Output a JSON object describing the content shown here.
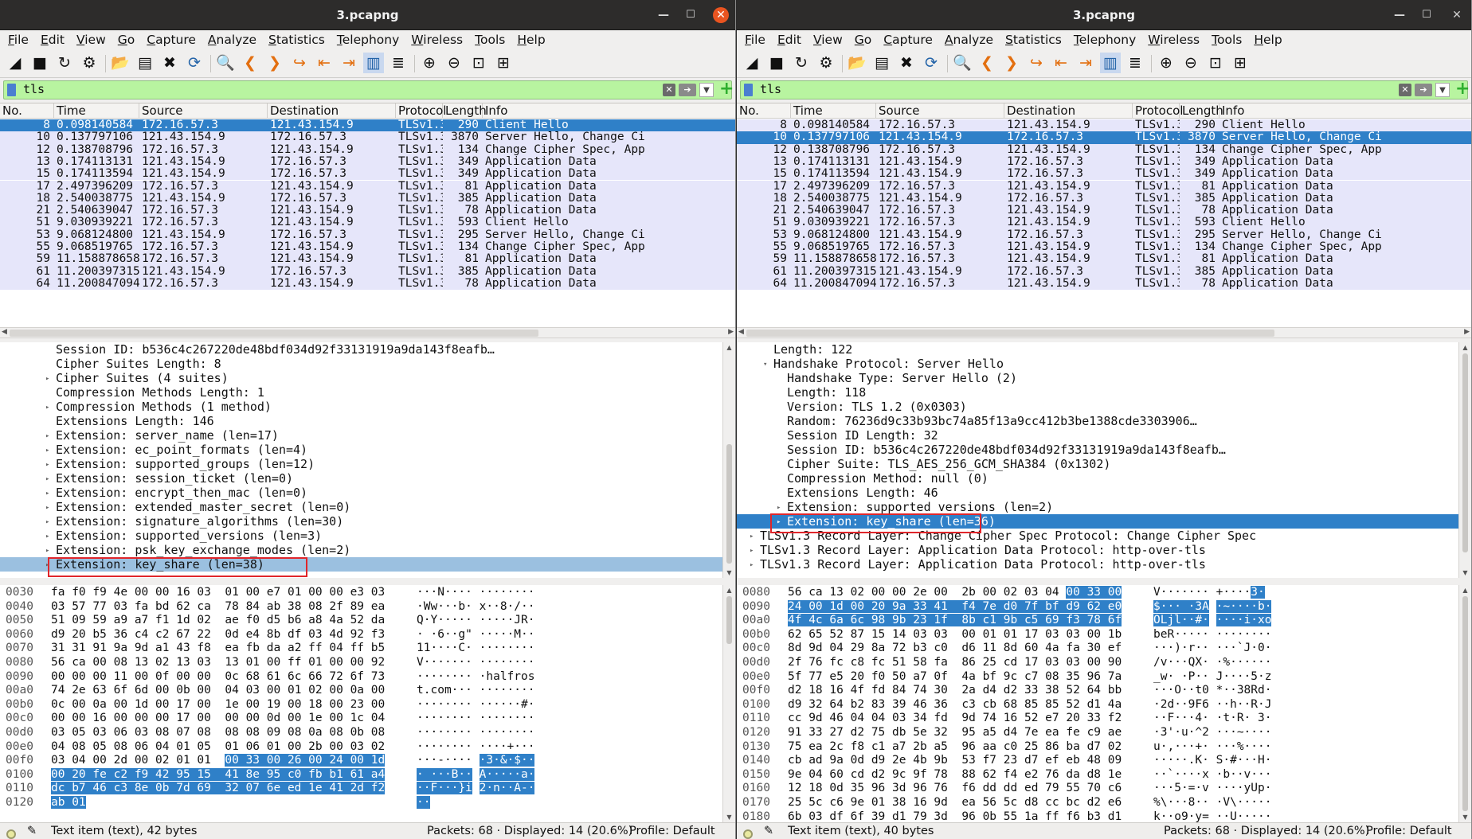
{
  "windows": [
    {
      "id": "L",
      "title": "3.pcapng",
      "menu": [
        "File",
        "Edit",
        "View",
        "Go",
        "Capture",
        "Analyze",
        "Statistics",
        "Telephony",
        "Wireless",
        "Tools",
        "Help"
      ],
      "filter": "tls",
      "columns": [
        "No.",
        "Time",
        "Source",
        "Destination",
        "Protocol",
        "Length",
        "Info"
      ],
      "selected_row": 0,
      "packets": [
        [
          "8",
          "0.098140584",
          "172.16.57.3",
          "121.43.154.9",
          "TLSv1.3",
          "290",
          "Client Hello"
        ],
        [
          "10",
          "0.137797106",
          "121.43.154.9",
          "172.16.57.3",
          "TLSv1.3",
          "3870",
          "Server Hello, Change Ci"
        ],
        [
          "12",
          "0.138708796",
          "172.16.57.3",
          "121.43.154.9",
          "TLSv1.3",
          "134",
          "Change Cipher Spec, App"
        ],
        [
          "13",
          "0.174113131",
          "121.43.154.9",
          "172.16.57.3",
          "TLSv1.3",
          "349",
          "Application Data"
        ],
        [
          "15",
          "0.174113594",
          "121.43.154.9",
          "172.16.57.3",
          "TLSv1.3",
          "349",
          "Application Data"
        ],
        [
          "17",
          "2.497396209",
          "172.16.57.3",
          "121.43.154.9",
          "TLSv1.3",
          "81",
          "Application Data"
        ],
        [
          "18",
          "2.540038775",
          "121.43.154.9",
          "172.16.57.3",
          "TLSv1.3",
          "385",
          "Application Data"
        ],
        [
          "21",
          "2.540639047",
          "172.16.57.3",
          "121.43.154.9",
          "TLSv1.3",
          "78",
          "Application Data"
        ],
        [
          "51",
          "9.030939221",
          "172.16.57.3",
          "121.43.154.9",
          "TLSv1.3",
          "593",
          "Client Hello"
        ],
        [
          "53",
          "9.068124800",
          "121.43.154.9",
          "172.16.57.3",
          "TLSv1.3",
          "295",
          "Server Hello, Change Ci"
        ],
        [
          "55",
          "9.068519765",
          "172.16.57.3",
          "121.43.154.9",
          "TLSv1.3",
          "134",
          "Change Cipher Spec, App"
        ],
        [
          "59",
          "11.158878658",
          "172.16.57.3",
          "121.43.154.9",
          "TLSv1.3",
          "81",
          "Application Data"
        ],
        [
          "61",
          "11.200397315",
          "121.43.154.9",
          "172.16.57.3",
          "TLSv1.3",
          "385",
          "Application Data"
        ],
        [
          "64",
          "11.200847094",
          "172.16.57.3",
          "121.43.154.9",
          "TLSv1.3",
          "78",
          "Application Data"
        ]
      ],
      "details": [
        {
          "indent": 0,
          "exp": "",
          "text": "Session ID: b536c4c267220de48bdf034d92f33131919a9da143f8eafb…"
        },
        {
          "indent": 0,
          "exp": "",
          "text": "Cipher Suites Length: 8"
        },
        {
          "indent": 0,
          "exp": "▸",
          "text": "Cipher Suites (4 suites)"
        },
        {
          "indent": 0,
          "exp": "",
          "text": "Compression Methods Length: 1"
        },
        {
          "indent": 0,
          "exp": "▸",
          "text": "Compression Methods (1 method)"
        },
        {
          "indent": 0,
          "exp": "",
          "text": "Extensions Length: 146"
        },
        {
          "indent": 0,
          "exp": "▸",
          "text": "Extension: server_name (len=17)"
        },
        {
          "indent": 0,
          "exp": "▸",
          "text": "Extension: ec_point_formats (len=4)"
        },
        {
          "indent": 0,
          "exp": "▸",
          "text": "Extension: supported_groups (len=12)"
        },
        {
          "indent": 0,
          "exp": "▸",
          "text": "Extension: session_ticket (len=0)"
        },
        {
          "indent": 0,
          "exp": "▸",
          "text": "Extension: encrypt_then_mac (len=0)"
        },
        {
          "indent": 0,
          "exp": "▸",
          "text": "Extension: extended_master_secret (len=0)"
        },
        {
          "indent": 0,
          "exp": "▸",
          "text": "Extension: signature_algorithms (len=30)"
        },
        {
          "indent": 0,
          "exp": "▸",
          "text": "Extension: supported_versions (len=3)"
        },
        {
          "indent": 0,
          "exp": "▸",
          "text": "Extension: psk_key_exchange_modes (len=2)"
        },
        {
          "indent": 0,
          "exp": "▸",
          "text": "Extension: key_share (len=38)",
          "sel": "light"
        }
      ],
      "bytes": [
        {
          "off": "0030",
          "hex": [
            "fa f0 f9 4e 00 00 16 03",
            "01 00 e7 01 00 00 e3 03"
          ],
          "ascii": [
            "···N····",
            "········"
          ]
        },
        {
          "off": "0040",
          "hex": [
            "03 57 77 03 fa bd 62 ca",
            "78 84 ab 38 08 2f 89 ea"
          ],
          "ascii": [
            "·Ww···b·",
            "x··8·/··"
          ]
        },
        {
          "off": "0050",
          "hex": [
            "51 09 59 a9 a7 f1 1d 02",
            "ae f0 d5 b6 a8 4a 52 da"
          ],
          "ascii": [
            "Q·Y·····",
            "·····JR·"
          ]
        },
        {
          "off": "0060",
          "hex": [
            "d9 20 b5 36 c4 c2 67 22",
            "0d e4 8b df 03 4d 92 f3"
          ],
          "ascii": [
            "· ·6··g\"",
            "·····M··"
          ]
        },
        {
          "off": "0070",
          "hex": [
            "31 31 91 9a 9d a1 43 f8",
            "ea fb da a2 ff 04 ff b5"
          ],
          "ascii": [
            "11····C·",
            "········"
          ]
        },
        {
          "off": "0080",
          "hex": [
            "56 ca 00 08 13 02 13 03",
            "13 01 00 ff 01 00 00 92"
          ],
          "ascii": [
            "V·······",
            "········"
          ]
        },
        {
          "off": "0090",
          "hex": [
            "00 00 00 11 00 0f 00 00",
            "0c 68 61 6c 66 72 6f 73"
          ],
          "ascii": [
            "········",
            "·halfros"
          ]
        },
        {
          "off": "00a0",
          "hex": [
            "74 2e 63 6f 6d 00 0b 00",
            "04 03 00 01 02 00 0a 00"
          ],
          "ascii": [
            "t.com···",
            "········"
          ]
        },
        {
          "off": "00b0",
          "hex": [
            "0c 00 0a 00 1d 00 17 00",
            "1e 00 19 00 18 00 23 00"
          ],
          "ascii": [
            "········",
            "······#·"
          ]
        },
        {
          "off": "00c0",
          "hex": [
            "00 00 16 00 00 00 17 00",
            "00 00 0d 00 1e 00 1c 04"
          ],
          "ascii": [
            "········",
            "········"
          ]
        },
        {
          "off": "00d0",
          "hex": [
            "03 05 03 06 03 08 07 08",
            "08 08 09 08 0a 08 0b 08"
          ],
          "ascii": [
            "········",
            "········"
          ]
        },
        {
          "off": "00e0",
          "hex": [
            "04 08 05 08 06 04 01 05",
            "01 06 01 00 2b 00 03 02"
          ],
          "ascii": [
            "········",
            "····+···"
          ]
        },
        {
          "off": "00f0",
          "hex": [
            "03 04 00 2d 00 02 01 01",
            "00 33 00 26 00 24 00 1d"
          ],
          "ascii": [
            "···-····",
            "·3·&·$··"
          ],
          "hlfrom": 8
        },
        {
          "off": "0100",
          "hex": [
            "00 20 fe c2 f9 42 95 15",
            "41 8e 95 c0 fb b1 61 a4"
          ],
          "ascii": [
            "· ···B··",
            "A·····a·"
          ],
          "hlfrom": 0
        },
        {
          "off": "0110",
          "hex": [
            "dc b7 46 c3 8e 0b 7d 69",
            "32 07 6e ed 1e 41 2d f2"
          ],
          "ascii": [
            "··F···}i",
            "2·n··A-·"
          ],
          "hlfrom": 0
        },
        {
          "off": "0120",
          "hex": [
            "ab 01",
            ""
          ],
          "ascii": [
            "··",
            ""
          ],
          "hlfrom": 0
        }
      ],
      "status": {
        "item": "Text item (text), 42 bytes",
        "packets": "Packets: 68 · Displayed: 14 (20.6%)",
        "profile": "Profile: Default"
      }
    },
    {
      "id": "R",
      "title": "3.pcapng",
      "menu": [
        "File",
        "Edit",
        "View",
        "Go",
        "Capture",
        "Analyze",
        "Statistics",
        "Telephony",
        "Wireless",
        "Tools",
        "Help"
      ],
      "filter": "tls",
      "columns": [
        "No.",
        "Time",
        "Source",
        "Destination",
        "Protocol",
        "Length",
        "Info"
      ],
      "selected_row": 1,
      "packets": [
        [
          "8",
          "0.098140584",
          "172.16.57.3",
          "121.43.154.9",
          "TLSv1.3",
          "290",
          "Client Hello"
        ],
        [
          "10",
          "0.137797106",
          "121.43.154.9",
          "172.16.57.3",
          "TLSv1.3",
          "3870",
          "Server Hello, Change Ci"
        ],
        [
          "12",
          "0.138708796",
          "172.16.57.3",
          "121.43.154.9",
          "TLSv1.3",
          "134",
          "Change Cipher Spec, App"
        ],
        [
          "13",
          "0.174113131",
          "121.43.154.9",
          "172.16.57.3",
          "TLSv1.3",
          "349",
          "Application Data"
        ],
        [
          "15",
          "0.174113594",
          "121.43.154.9",
          "172.16.57.3",
          "TLSv1.3",
          "349",
          "Application Data"
        ],
        [
          "17",
          "2.497396209",
          "172.16.57.3",
          "121.43.154.9",
          "TLSv1.3",
          "81",
          "Application Data"
        ],
        [
          "18",
          "2.540038775",
          "121.43.154.9",
          "172.16.57.3",
          "TLSv1.3",
          "385",
          "Application Data"
        ],
        [
          "21",
          "2.540639047",
          "172.16.57.3",
          "121.43.154.9",
          "TLSv1.3",
          "78",
          "Application Data"
        ],
        [
          "51",
          "9.030939221",
          "172.16.57.3",
          "121.43.154.9",
          "TLSv1.3",
          "593",
          "Client Hello"
        ],
        [
          "53",
          "9.068124800",
          "121.43.154.9",
          "172.16.57.3",
          "TLSv1.3",
          "295",
          "Server Hello, Change Ci"
        ],
        [
          "55",
          "9.068519765",
          "172.16.57.3",
          "121.43.154.9",
          "TLSv1.3",
          "134",
          "Change Cipher Spec, App"
        ],
        [
          "59",
          "11.158878658",
          "172.16.57.3",
          "121.43.154.9",
          "TLSv1.3",
          "81",
          "Application Data"
        ],
        [
          "61",
          "11.200397315",
          "121.43.154.9",
          "172.16.57.3",
          "TLSv1.3",
          "385",
          "Application Data"
        ],
        [
          "64",
          "11.200847094",
          "172.16.57.3",
          "121.43.154.9",
          "TLSv1.3",
          "78",
          "Application Data"
        ]
      ],
      "details": [
        {
          "indent": 1,
          "exp": "",
          "text": "Length: 122"
        },
        {
          "indent": 1,
          "exp": "▾",
          "text": "Handshake Protocol: Server Hello"
        },
        {
          "indent": 2,
          "exp": "",
          "text": "Handshake Type: Server Hello (2)"
        },
        {
          "indent": 2,
          "exp": "",
          "text": "Length: 118"
        },
        {
          "indent": 2,
          "exp": "",
          "text": "Version: TLS 1.2 (0x0303)"
        },
        {
          "indent": 2,
          "exp": "",
          "text": "Random: 76236d9c33b93bc74a85f13a9cc412b3be1388cde3303906…"
        },
        {
          "indent": 2,
          "exp": "",
          "text": "Session ID Length: 32"
        },
        {
          "indent": 2,
          "exp": "",
          "text": "Session ID: b536c4c267220de48bdf034d92f33131919a9da143f8eafb…"
        },
        {
          "indent": 2,
          "exp": "",
          "text": "Cipher Suite: TLS_AES_256_GCM_SHA384 (0x1302)"
        },
        {
          "indent": 2,
          "exp": "",
          "text": "Compression Method: null (0)"
        },
        {
          "indent": 2,
          "exp": "",
          "text": "Extensions Length: 46"
        },
        {
          "indent": 2,
          "exp": "▸",
          "text": "Extension: supported_versions (len=2)"
        },
        {
          "indent": 2,
          "exp": "▸",
          "text": "Extension: key_share (len=36)",
          "sel": "dark"
        },
        {
          "indent": 0,
          "exp": "▸",
          "text": "TLSv1.3 Record Layer: Change Cipher Spec Protocol: Change Cipher Spec"
        },
        {
          "indent": 0,
          "exp": "▸",
          "text": "TLSv1.3 Record Layer: Application Data Protocol: http-over-tls"
        },
        {
          "indent": 0,
          "exp": "▸",
          "text": "TLSv1.3 Record Layer: Application Data Protocol: http-over-tls"
        }
      ],
      "bytes": [
        {
          "off": "0080",
          "hex": [
            "56 ca 13 02 00 00 2e 00",
            "2b 00 02 03 04 00 33 00"
          ],
          "ascii": [
            "V·······",
            "+····3·"
          ],
          "hlfrom": 13
        },
        {
          "off": "0090",
          "hex": [
            "24 00 1d 00 20 9a 33 41",
            "f4 7e d0 7f bf d9 62 e0"
          ],
          "ascii": [
            "$··· ·3A",
            "·~····b·"
          ],
          "hlfrom": 0
        },
        {
          "off": "00a0",
          "hex": [
            "4f 4c 6a 6c 98 9b 23 1f",
            "8b c1 9b c5 69 f3 78 6f"
          ],
          "ascii": [
            "OLjl··#·",
            "····i·xo"
          ],
          "hlfrom": 0
        },
        {
          "off": "00b0",
          "hex": [
            "62 65 52 87 15 14 03 03",
            "00 01 01 17 03 03 00 1b"
          ],
          "ascii": [
            "beR·····",
            "········"
          ],
          "hlto": 5
        },
        {
          "off": "00c0",
          "hex": [
            "8d 9d 04 29 8a 72 b3 c0",
            "d6 11 8d 60 4a fa 30 ef"
          ],
          "ascii": [
            "···)·r··",
            "···`J·0·"
          ]
        },
        {
          "off": "00d0",
          "hex": [
            "2f 76 fc c8 fc 51 58 fa",
            "86 25 cd 17 03 03 00 90"
          ],
          "ascii": [
            "/v···QX·",
            "·%······"
          ]
        },
        {
          "off": "00e0",
          "hex": [
            "5f 77 e5 20 f0 50 a7 0f",
            "4a bf 9c c7 08 35 96 7a"
          ],
          "ascii": [
            "_w· ·P··",
            "J····5·z"
          ]
        },
        {
          "off": "00f0",
          "hex": [
            "d2 18 16 4f fd 84 74 30",
            "2a d4 d2 33 38 52 64 bb"
          ],
          "ascii": [
            "···O··t0",
            "*··38Rd·"
          ]
        },
        {
          "off": "0100",
          "hex": [
            "d9 32 64 b2 83 39 46 36",
            "c3 cb 68 85 85 52 d1 4a"
          ],
          "ascii": [
            "·2d··9F6",
            "··h··R·J"
          ]
        },
        {
          "off": "0110",
          "hex": [
            "cc 9d 46 04 04 03 34 fd",
            "9d 74 16 52 e7 20 33 f2"
          ],
          "ascii": [
            "··F···4·",
            "·t·R· 3·"
          ]
        },
        {
          "off": "0120",
          "hex": [
            "91 33 27 d2 75 db 5e 32",
            "95 a5 d4 7e ea fe c9 ae"
          ],
          "ascii": [
            "·3'·u·^2",
            "···~····"
          ]
        },
        {
          "off": "0130",
          "hex": [
            "75 ea 2c f8 c1 a7 2b a5",
            "96 aa c0 25 86 ba d7 02"
          ],
          "ascii": [
            "u·,···+·",
            "···%····"
          ]
        },
        {
          "off": "0140",
          "hex": [
            "cb ad 9a 0d d9 2e 4b 9b",
            "53 f7 23 d7 ef eb 48 09"
          ],
          "ascii": [
            "·····.K·",
            "S·#···H·"
          ]
        },
        {
          "off": "0150",
          "hex": [
            "9e 04 60 cd d2 9c 9f 78",
            "88 62 f4 e2 76 da d8 1e"
          ],
          "ascii": [
            "··`····x",
            "·b··v···"
          ]
        },
        {
          "off": "0160",
          "hex": [
            "12 18 0d 35 96 3d 96 76",
            "f6 dd dd ed 79 55 70 c6"
          ],
          "ascii": [
            "···5·=·v",
            "····yUp·"
          ]
        },
        {
          "off": "0170",
          "hex": [
            "25 5c c6 9e 01 38 16 9d",
            "ea 56 5c d8 cc bc d2 e6"
          ],
          "ascii": [
            "%\\···8··",
            "·V\\·····"
          ]
        },
        {
          "off": "0180",
          "hex": [
            "6b 03 df 6f 39 d1 79 3d",
            "96 0b 55 1a ff f6 b3 d1"
          ],
          "ascii": [
            "k··o9·y=",
            "··U·····"
          ]
        }
      ],
      "status": {
        "item": "Text item (text), 40 bytes",
        "packets": "Packets: 68 · Displayed: 14 (20.6%)",
        "profile": "Profile: Default"
      }
    }
  ]
}
